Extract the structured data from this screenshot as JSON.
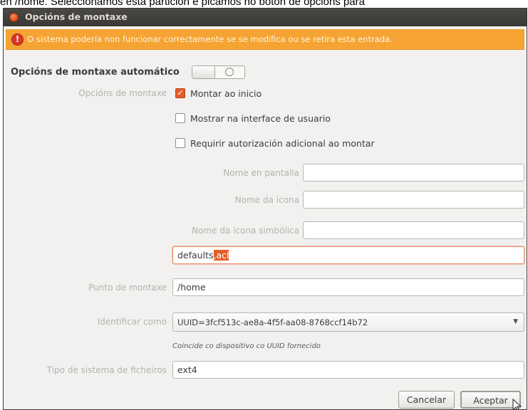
{
  "caption": "en /home. Seleccionamos esta partición e picamos no botón de opcións para",
  "window": {
    "title": "Opcións de montaxe"
  },
  "warning": {
    "icon": "error-icon",
    "text": "O sistema podería non funcionar correctamente se se modifica ou se retira esta entrada."
  },
  "auto_mount": {
    "label": "Opcións de montaxe automático",
    "switch_on": false
  },
  "mount_options": {
    "label": "Opcións de montaxe",
    "checkboxes": [
      {
        "label": "Montar ao inicio",
        "checked": true
      },
      {
        "label": "Mostrar na interface de usuario",
        "checked": false
      },
      {
        "label": "Requirir autorización adicional ao montar",
        "checked": false
      }
    ],
    "display_name_label": "Nome en pantalla",
    "display_name_value": "",
    "icon_name_label": "Nome da icona",
    "icon_name_value": "",
    "symbolic_icon_label": "Nome da icona simbólica",
    "symbolic_icon_value": "",
    "options_text": "defaults",
    "options_selected": ",acl"
  },
  "mount_point": {
    "label": "Punto de montaxe",
    "value": "/home"
  },
  "identify": {
    "label": "Identificar como",
    "value": "UUID=3fcf513c-ae8a-4f5f-aa08-8768ccf14b72",
    "hint": "Coincide co dispositivo co UUID fornecido"
  },
  "fs_type": {
    "label": "Tipo de sistema de ficheiros",
    "value": "ext4"
  },
  "buttons": {
    "cancel": "Cancelar",
    "ok": "Aceptar"
  },
  "colors": {
    "accent": "#e35d27",
    "warning_bg": "#f5a433",
    "titlebar": "#3c3b37"
  }
}
